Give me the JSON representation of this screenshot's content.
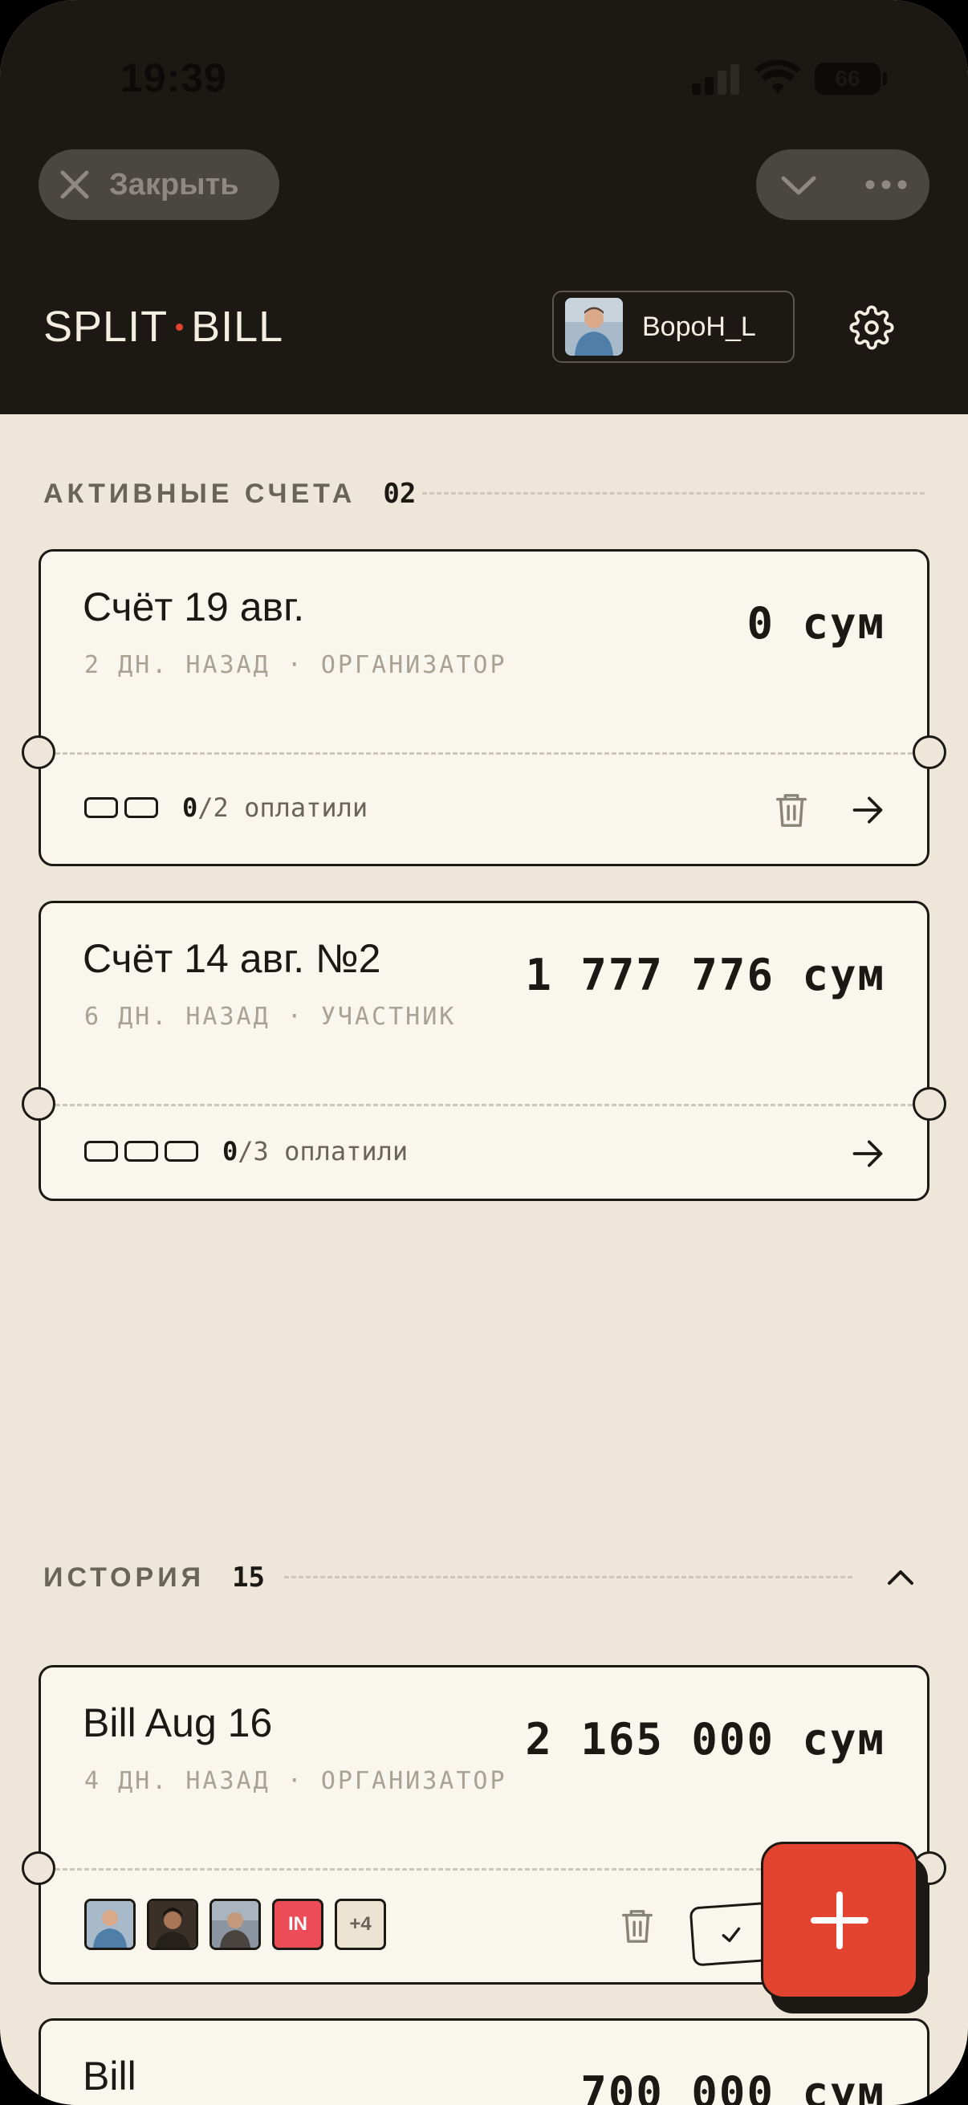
{
  "status_bar": {
    "time": "19:39",
    "battery": "66"
  },
  "browser": {
    "close_label": "Закрыть"
  },
  "header": {
    "brand_left": "SPLIT",
    "brand_right": "BILL",
    "username": "ВороН_L"
  },
  "active": {
    "title": "АКТИВНЫЕ СЧЕТА",
    "count": "02",
    "bills": [
      {
        "title": "Счёт 19 авг.",
        "meta": "2 ДН. НАЗАД · ОРГАНИЗАТОР",
        "amount": "0 сум",
        "paid": "0",
        "total": "/2",
        "paid_suffix": "оплатили"
      },
      {
        "title": "Счёт 14 авг. №2",
        "meta": "6 ДН. НАЗАД · УЧАСТНИК",
        "amount": "1 777 776 сум",
        "paid": "0",
        "total": "/3",
        "paid_suffix": "оплатили"
      }
    ]
  },
  "history": {
    "title": "ИСТОРИЯ",
    "count": "15",
    "bills": [
      {
        "title": "Bill Aug 16",
        "meta": "4 ДН. НАЗАД · ОРГАНИЗАТОР",
        "amount": "2 165 000 сум",
        "avatar_in": "IN",
        "avatar_more": "+4"
      },
      {
        "title": "Bill",
        "amount": "700 000 сум"
      }
    ]
  },
  "colors": {
    "accent": "#e2442f",
    "dark": "#1c1915",
    "background": "#ede6d9",
    "card": "#f9f6ed"
  },
  "icons": [
    "close-icon",
    "chevron-down-icon",
    "more-icon",
    "gear-icon",
    "trash-icon",
    "arrow-right-icon",
    "chevron-up-icon",
    "check-icon",
    "plus-icon"
  ]
}
